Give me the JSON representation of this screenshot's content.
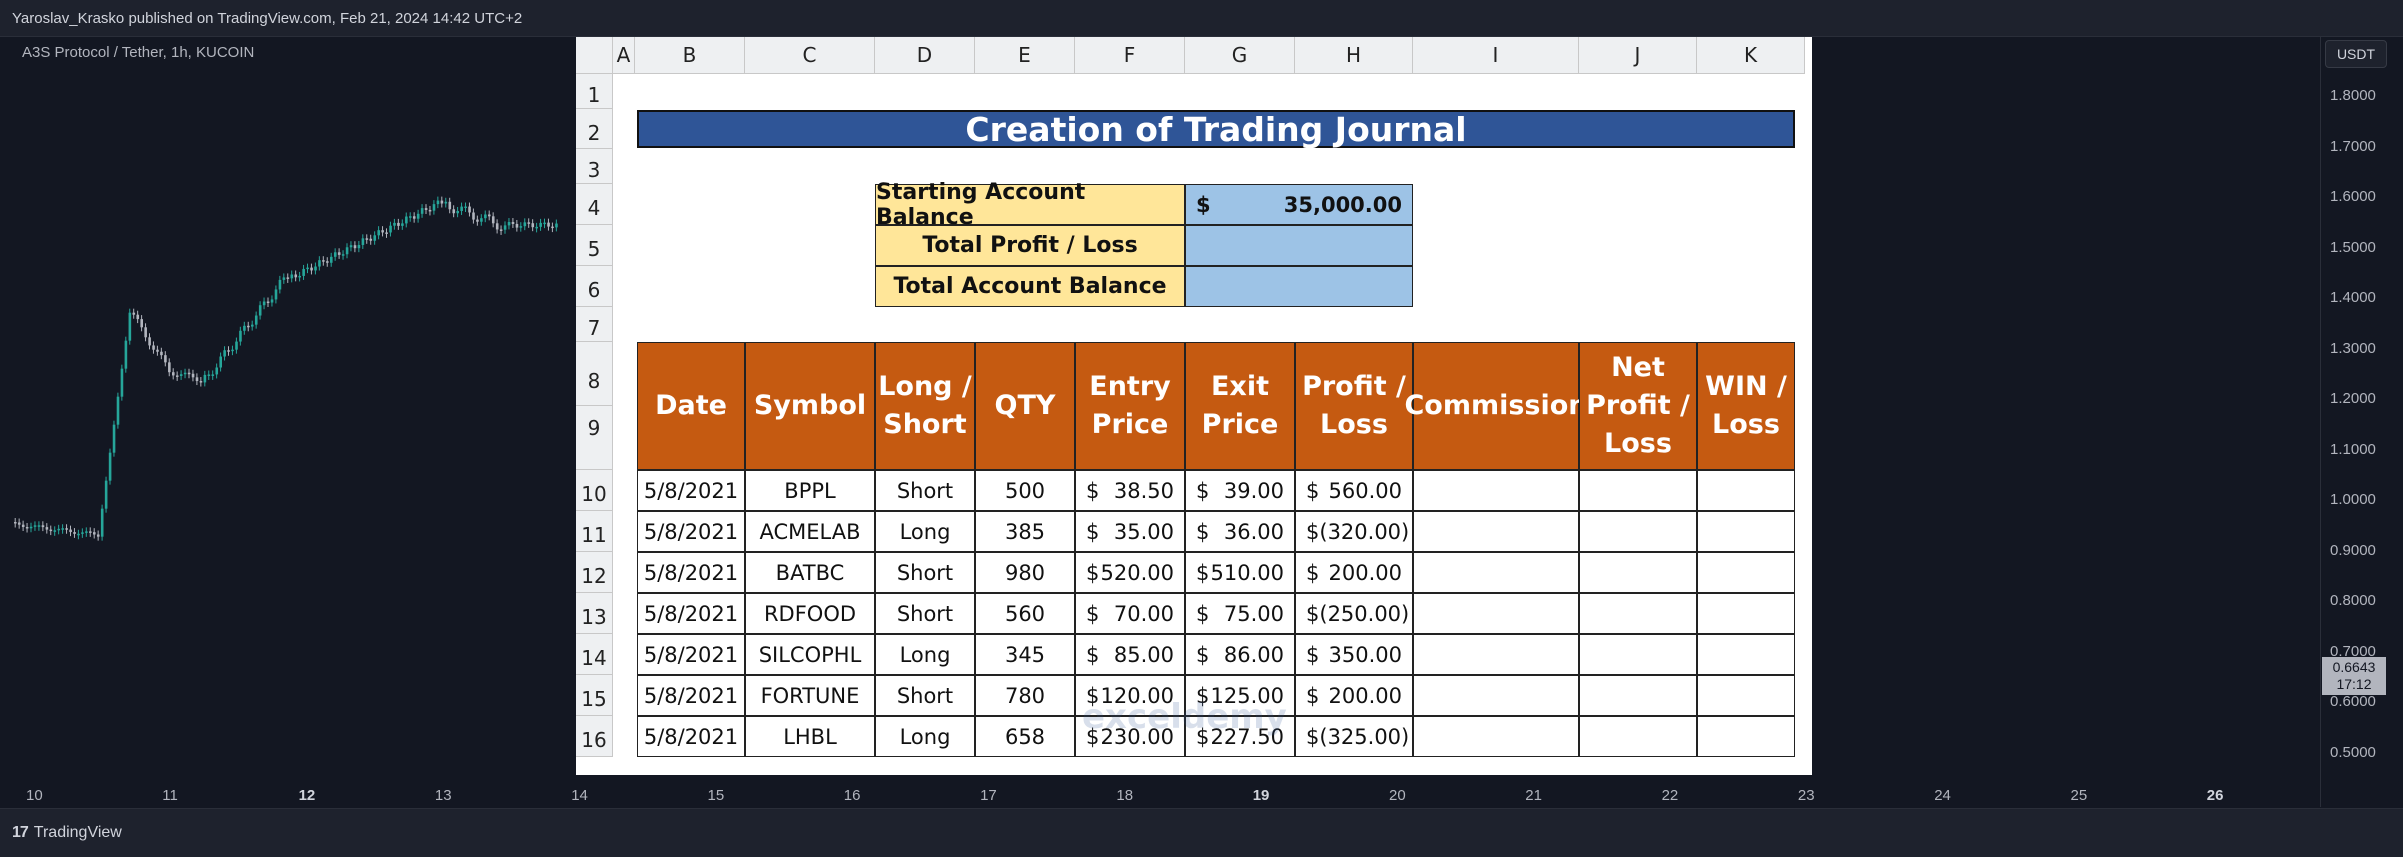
{
  "header": {
    "published": "Yaroslav_Krasko published on TradingView.com, Feb 21, 2024 14:42 UTC+2"
  },
  "symbol": "A3S Protocol / Tether, 1h, KUCOIN",
  "currency_button": "USDT",
  "price_labels": [
    "1.8000",
    "1.7000",
    "1.6000",
    "1.5000",
    "1.4000",
    "1.3000",
    "1.2000",
    "1.1000",
    "1.0000",
    "0.9000",
    "0.8000",
    "0.7000",
    "0.6000",
    "0.5000"
  ],
  "current_price": {
    "value": "0.6643",
    "countdown": "17:12"
  },
  "time_labels": [
    {
      "text": "10",
      "bold": false
    },
    {
      "text": "11",
      "bold": false
    },
    {
      "text": "12",
      "bold": true
    },
    {
      "text": "13",
      "bold": false
    },
    {
      "text": "14",
      "bold": false
    },
    {
      "text": "15",
      "bold": false
    },
    {
      "text": "16",
      "bold": false
    },
    {
      "text": "17",
      "bold": false
    },
    {
      "text": "18",
      "bold": false
    },
    {
      "text": "19",
      "bold": true
    },
    {
      "text": "20",
      "bold": false
    },
    {
      "text": "21",
      "bold": false
    },
    {
      "text": "22",
      "bold": false
    },
    {
      "text": "23",
      "bold": false
    },
    {
      "text": "24",
      "bold": false
    },
    {
      "text": "25",
      "bold": false
    },
    {
      "text": "26",
      "bold": true
    }
  ],
  "footer": {
    "logo_mark": "17",
    "brand": "TradingView"
  },
  "colors": {
    "up": "#26a69a",
    "down": "#b2b5be",
    "title_bg": "#2f5597",
    "header_bg": "#c55a11",
    "label_bg": "#ffe699",
    "value_bg": "#9dc3e6"
  },
  "spreadsheet": {
    "columns": [
      "A",
      "B",
      "C",
      "D",
      "E",
      "F",
      "G",
      "H",
      "I",
      "J",
      "K"
    ],
    "rows": [
      "1",
      "2",
      "3",
      "4",
      "5",
      "6",
      "7",
      "8",
      "9",
      "10",
      "11",
      "12",
      "13",
      "14",
      "15",
      "16"
    ],
    "title": "Creation of Trading Journal",
    "summary": [
      {
        "label": "Starting Account Balance",
        "currency": "$",
        "value": "35,000.00"
      },
      {
        "label": "Total Profit / Loss",
        "currency": "",
        "value": ""
      },
      {
        "label": "Total Account Balance",
        "currency": "",
        "value": ""
      }
    ],
    "headers": [
      "Date",
      "Symbol",
      "Long / Short",
      "QTY",
      "Entry Price",
      "Exit Price",
      "Profit / Loss",
      "Commission",
      "Net Profit / Loss",
      "WIN / Loss"
    ],
    "trades": [
      {
        "date": "5/8/2021",
        "symbol": "BPPL",
        "side": "Short",
        "qty": "500",
        "entry": "38.50",
        "exit": "39.00",
        "pl": "560.00"
      },
      {
        "date": "5/8/2021",
        "symbol": "ACMELAB",
        "side": "Long",
        "qty": "385",
        "entry": "35.00",
        "exit": "36.00",
        "pl": "(320.00)"
      },
      {
        "date": "5/8/2021",
        "symbol": "BATBC",
        "side": "Short",
        "qty": "980",
        "entry": "520.00",
        "exit": "510.00",
        "pl": "200.00"
      },
      {
        "date": "5/8/2021",
        "symbol": "RDFOOD",
        "side": "Short",
        "qty": "560",
        "entry": "70.00",
        "exit": "75.00",
        "pl": "(250.00)"
      },
      {
        "date": "5/8/2021",
        "symbol": "SILCOPHL",
        "side": "Long",
        "qty": "345",
        "entry": "85.00",
        "exit": "86.00",
        "pl": "350.00"
      },
      {
        "date": "5/8/2021",
        "symbol": "FORTUNE",
        "side": "Short",
        "qty": "780",
        "entry": "120.00",
        "exit": "125.00",
        "pl": "200.00"
      },
      {
        "date": "5/8/2021",
        "symbol": "LHBL",
        "side": "Long",
        "qty": "658",
        "entry": "230.00",
        "exit": "227.50",
        "pl": "(325.00)"
      }
    ],
    "currency_symbol": "$",
    "watermark": "exceldemy"
  }
}
